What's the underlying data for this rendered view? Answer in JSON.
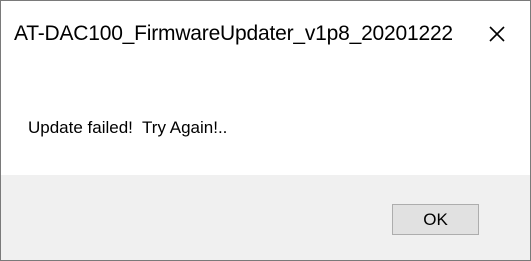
{
  "window": {
    "title": "AT-DAC100_FirmwareUpdater_v1p8_20201222",
    "close_icon": "close-icon"
  },
  "message": {
    "text": "Update failed!  Try Again!.."
  },
  "buttons": {
    "ok_label": "OK"
  },
  "colors": {
    "footer_background": "#f0f0f0",
    "button_background": "#e1e1e1",
    "button_border": "#adadad",
    "window_border": "#7a7a7a"
  }
}
